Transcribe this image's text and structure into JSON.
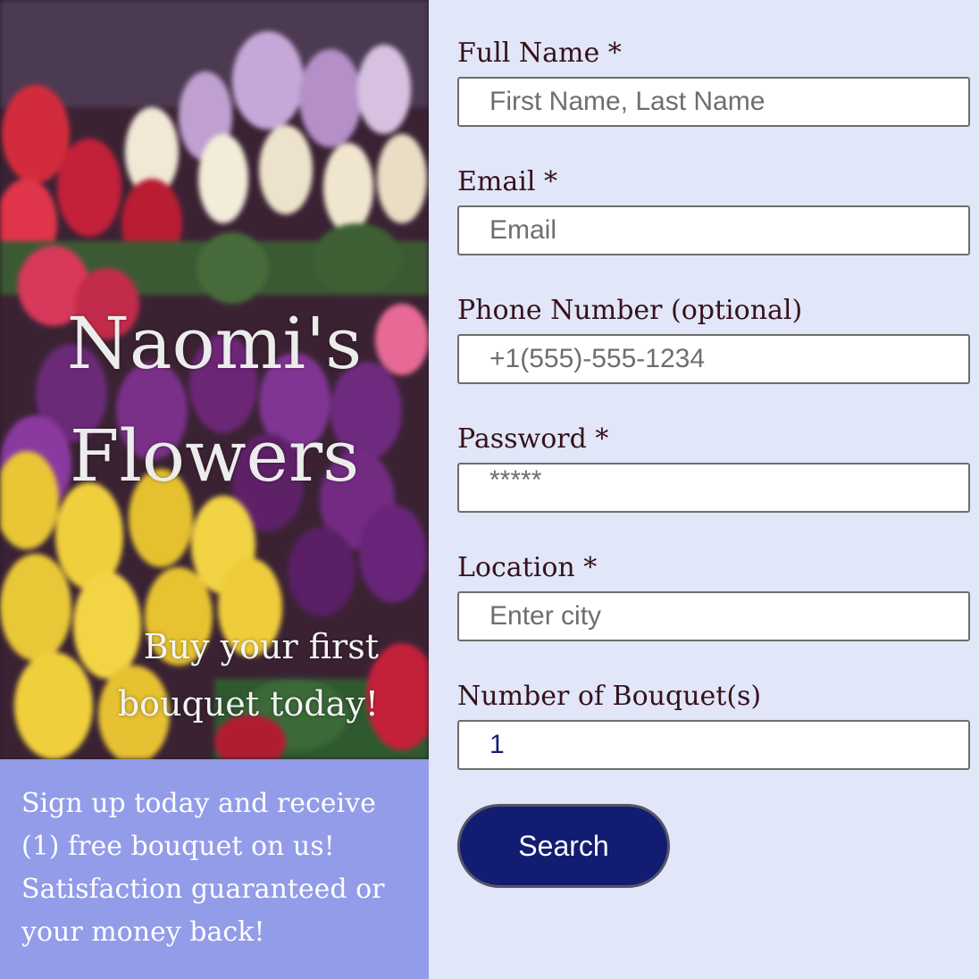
{
  "hero": {
    "title_line1": "Naomi's",
    "title_line2": "Flowers",
    "tagline_line1": "Buy your first",
    "tagline_line2": "bouquet today!"
  },
  "promo": {
    "text": "Sign up today and receive (1) free bouquet on us! Satisfaction guaranteed or your money back!"
  },
  "form": {
    "full_name": {
      "label": "Full Name *",
      "placeholder": "First Name, Last Name"
    },
    "email": {
      "label": "Email *",
      "placeholder": "Email"
    },
    "phone": {
      "label": "Phone Number (optional)",
      "placeholder": "+1(555)-555-1234"
    },
    "password": {
      "label": "Password *",
      "placeholder": "*****"
    },
    "location": {
      "label": "Location *",
      "placeholder": "Enter city"
    },
    "bouquets": {
      "label": "Number of Bouquet(s)",
      "value": "1"
    },
    "submit_label": "Search"
  },
  "colors": {
    "page_background": "#e1e6f8",
    "promo_background": "#939ce9",
    "button_background": "#121d72",
    "label_text": "#35111c"
  }
}
